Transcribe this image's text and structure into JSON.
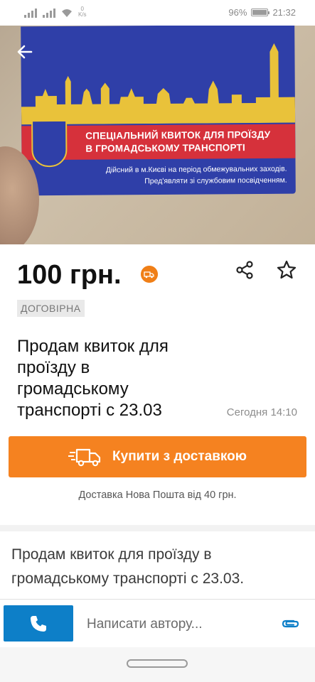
{
  "status_bar": {
    "net_speed_value": "0",
    "net_speed_unit": "K/s",
    "battery": "96%",
    "battery_level": 0.96,
    "time": "21:32"
  },
  "photo": {
    "card_line1": "СПЕЦІАЛЬНИЙ КВИТОК ДЛЯ ПРОЇЗДУ",
    "card_line2": "В ГРОМАДСЬКОМУ ТРАНСПОРТІ",
    "card_line3": "Дійсний в м.Києві на період обмежувальних заходів.",
    "card_line4": "Пред'являти зі службовим посвідченням."
  },
  "listing": {
    "price": "100 грн.",
    "negotiable": "ДОГОВІРНА",
    "title": "Продам квиток для проїзду в громадському транспорті с 23.03",
    "posted": "Сегодня 14:10"
  },
  "buy": {
    "label": "Купити з доставкою",
    "note": "Доставка Нова Пошта від 40 грн."
  },
  "description": "Продам квиток для проїзду в громадському транспорті с 23.03.",
  "bottom_bar": {
    "message_placeholder": "Написати автору..."
  },
  "colors": {
    "accent_orange": "#f58220",
    "call_blue": "#0d7fc8",
    "card_blue": "#2f3fa8",
    "card_red": "#d6313b",
    "card_gold": "#e9c23a"
  },
  "icons": {
    "back": "arrow-left-icon",
    "share": "share-icon",
    "favorite": "star-outline-icon",
    "delivery": "truck-icon",
    "call": "phone-icon",
    "attach": "paperclip-icon"
  }
}
